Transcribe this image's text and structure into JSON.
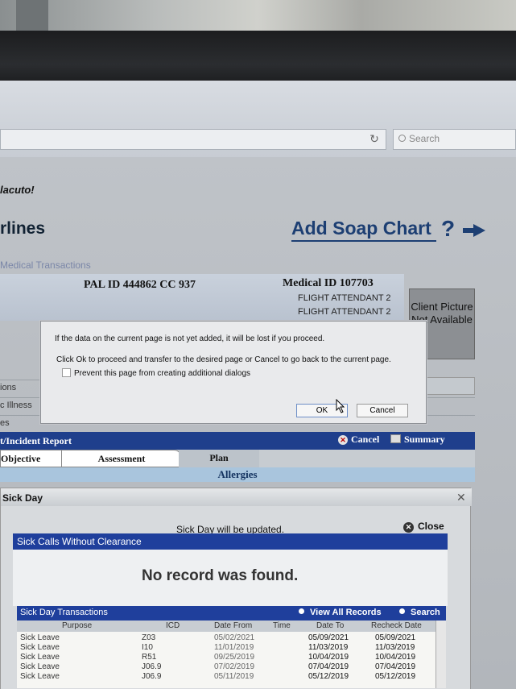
{
  "browser": {
    "search_placeholder": "Search"
  },
  "header": {
    "greeting": "lacuto!",
    "brand": "rlines",
    "title": "Add Soap Chart",
    "help": "?",
    "breadcrumb": "Medical Transactions"
  },
  "patient": {
    "pal_id": "PAL ID 444862  CC 937",
    "medical_id": "Medical ID 107703",
    "position_1": "FLIGHT ATTENDANT 2",
    "position_2": "FLIGHT ATTENDANT 2",
    "picture_text": "Client Picture Not Available"
  },
  "side_items": [
    "",
    "ions",
    "c Illness",
    "es"
  ],
  "incident": {
    "title": "t/Incident Report",
    "cancel": "Cancel",
    "summary": "Summary"
  },
  "tabs": {
    "objective": "Objective",
    "assessment": "Assessment",
    "plan": "Plan",
    "allergies": "Allergies"
  },
  "sick_day": {
    "title": "Sick Day",
    "message": "Sick Day will be updated.",
    "close": "Close",
    "calls_title": "Sick Calls Without Clearance",
    "no_record": "No record was found.",
    "transactions_title": "Sick Day Transactions",
    "view_all": "View All Records",
    "search": "Search",
    "columns": [
      "Purpose",
      "ICD",
      "Date From",
      "Time",
      "Date To",
      "Recheck Date"
    ],
    "rows": [
      [
        "Sick Leave",
        "Z03",
        "05/02/2021",
        "",
        "05/09/2021",
        "05/09/2021"
      ],
      [
        "Sick Leave",
        "I10",
        "11/01/2019",
        "",
        "11/03/2019",
        "11/03/2019"
      ],
      [
        "Sick Leave",
        "R51",
        "09/25/2019",
        "",
        "10/04/2019",
        "10/04/2019"
      ],
      [
        "Sick Leave",
        "J06.9",
        "07/02/2019",
        "",
        "07/04/2019",
        "07/04/2019"
      ],
      [
        "Sick Leave",
        "J06.9",
        "05/11/2019",
        "",
        "05/12/2019",
        "05/12/2019"
      ]
    ]
  },
  "dialog": {
    "line1": "If the data on the current page is not yet added, it will be lost if you proceed.",
    "line2": "Click Ok to proceed and transfer to the desired page or Cancel to go back to the current page.",
    "checkbox_label": "Prevent this page from creating additional dialogs",
    "ok": "OK",
    "cancel": "Cancel"
  },
  "colors": {
    "accent_blue": "#1f3f9c",
    "title_blue": "#1d3f73"
  }
}
